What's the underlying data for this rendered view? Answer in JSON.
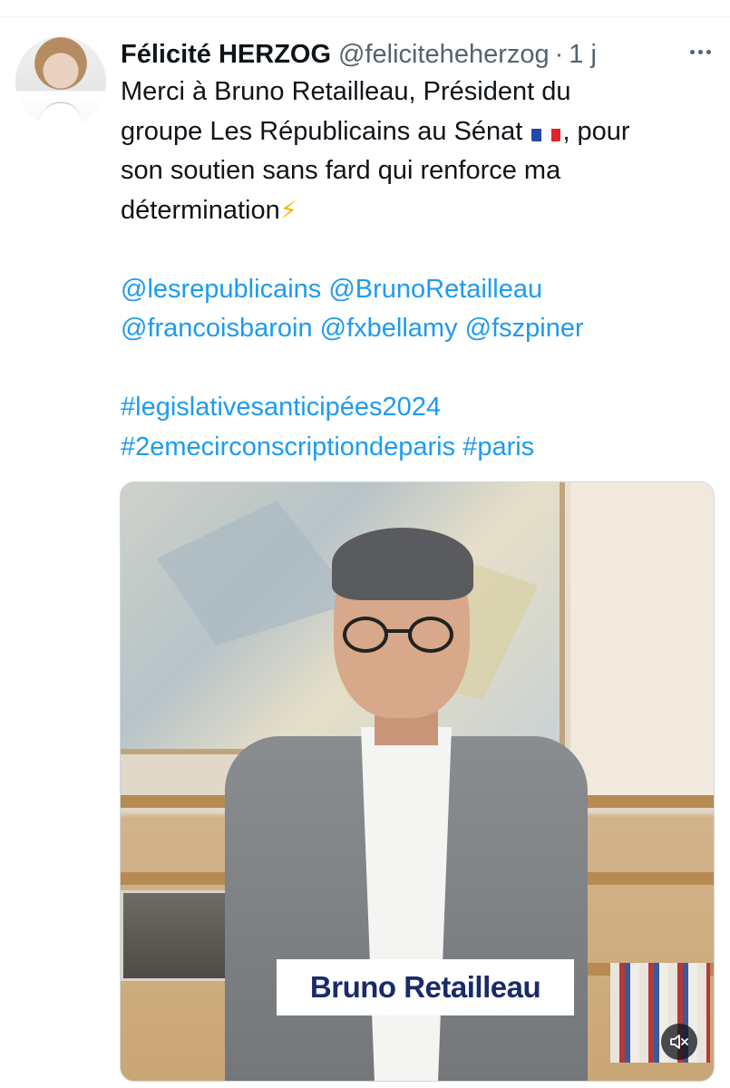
{
  "tweet": {
    "author": {
      "display_name": "Félicité HERZOG",
      "handle": "@feliciteheherzog",
      "avatar_icon": "profile-photo"
    },
    "separator": "·",
    "time": "1 j",
    "more_icon": "more-horizontal-icon",
    "text_lines": [
      "Merci à Bruno Retailleau, Président du",
      "groupe Les Républicains au Sénat",
      ", pour",
      "son soutien sans fard qui renforce ma",
      "détermination"
    ],
    "flag_icon": "france-flag-emoji",
    "bolt_icon": "high-voltage-emoji",
    "mentions_line1": "@lesrepublicains @BrunoRetailleau",
    "mentions_line2": "@francoisbaroin @fxbellamy @fszpiner",
    "hashtags_line1": "#legislativesanticipées2024",
    "hashtags_line2": "#2emecirconscriptiondeparis #paris",
    "video": {
      "caption": "Bruno Retailleau",
      "mute_icon": "volume-muted-icon"
    }
  },
  "colors": {
    "link": "#1d9bf0",
    "text": "#0f1419",
    "secondary": "#536471",
    "caption_text": "#1a2b6b"
  }
}
